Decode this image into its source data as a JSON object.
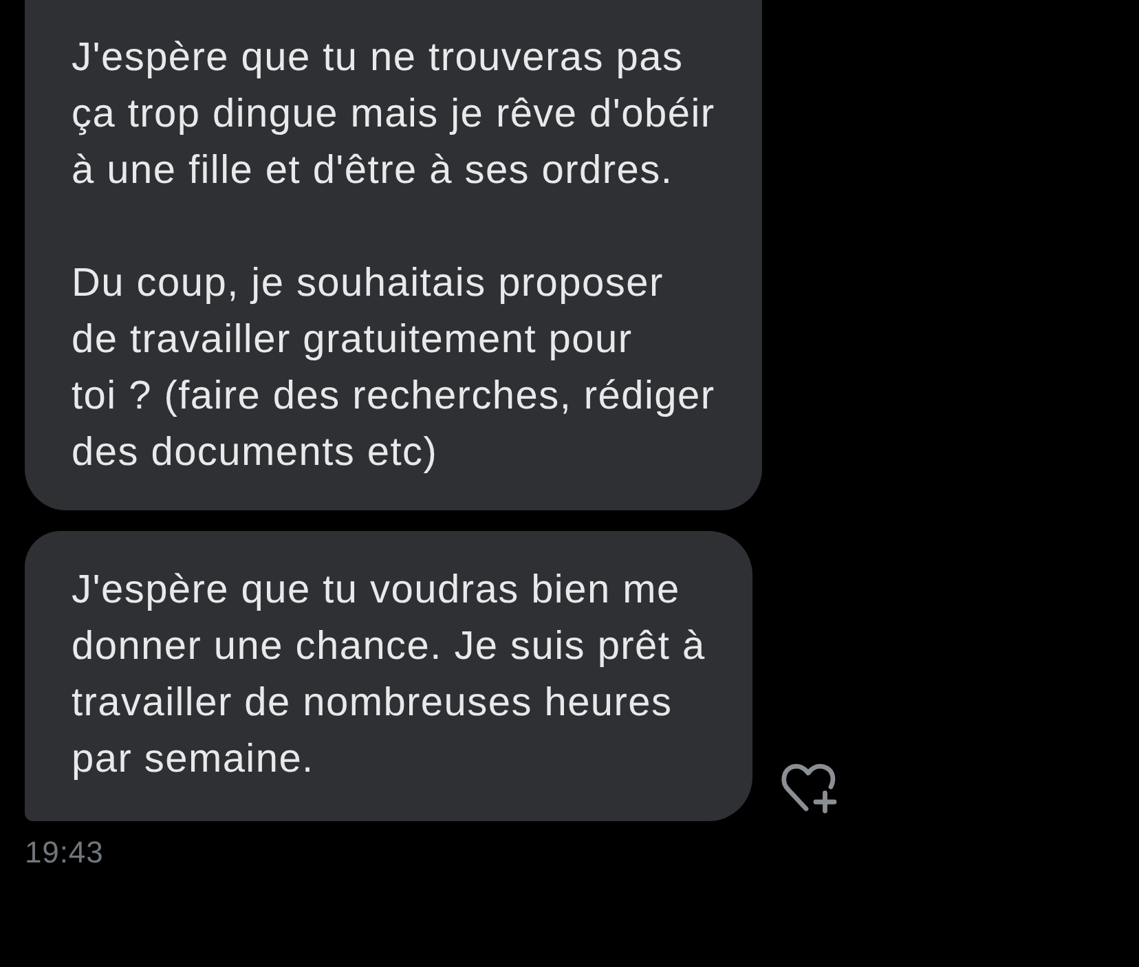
{
  "messages": [
    {
      "paragraphs": [
        "J'espère que tu ne trouveras pas\nça trop dingue mais je rêve d'obéir\nà une fille et d'être à ses ordres.",
        "Du coup, je souhaitais proposer\nde travailler gratuitement pour\ntoi ? (faire des recherches, rédiger\ndes documents etc)"
      ]
    },
    {
      "paragraphs": [
        "J'espère que tu voudras bien me\ndonner une chance. Je suis prêt à\ntravailler de nombreuses heures\npar semaine."
      ]
    }
  ],
  "timestamp": "19:43"
}
